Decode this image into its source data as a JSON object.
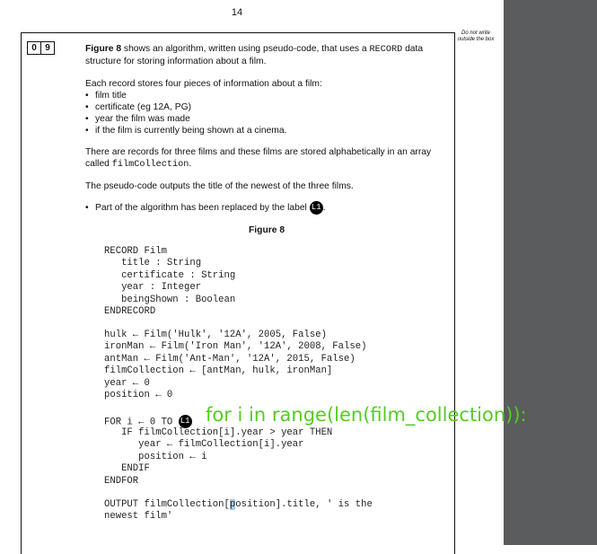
{
  "page_number": "14",
  "margin_note": "Do not write outside the box",
  "question_number": [
    "0",
    "9"
  ],
  "intro": {
    "fig_ref": "Figure 8",
    "text1": " shows an algorithm, written using pseudo-code, that uses a ",
    "record_word": "RECORD",
    "text2": " data structure for storing information about a film."
  },
  "record_intro": "Each record stores four pieces of information about a film:",
  "bullets": [
    "film title",
    "certificate (eg 12A, PG)",
    "year the film was made",
    "if the film is currently being shown at a cinema."
  ],
  "array_text": "There are records for three films and these films are stored alphabetically in an array called ",
  "array_name": "filmCollection",
  "array_end": ".",
  "output_text": "The pseudo-code outputs the title of the newest of the three films.",
  "replaced_text": "Part of the algorithm has been replaced by the label ",
  "label": "L1",
  "figure_caption": "Figure 8",
  "code_block1": "RECORD Film\n   title : String\n   certificate : String\n   year : Integer\n   beingShown : Boolean\nENDRECORD",
  "code_block2": "hulk ← Film('Hulk', '12A', 2005, False)\nironMan ← Film('Iron Man', '12A', 2008, False)\nantMan ← Film('Ant-Man', '12A', 2015, False)\nfilmCollection ← [antMan, hulk, ironMan]\nyear ← 0\nposition ← 0",
  "for_line_prefix": "FOR i ← 0 TO ",
  "code_block3": "   IF filmCollection[i].year > year THEN\n      year ← filmCollection[i].year\n      position ← i\n   ENDIF\nENDFOR",
  "output_line_a": "OUTPUT filmCollection[",
  "output_cursor_char": "p",
  "output_line_b": "osition].title, ' is the\nnewest film'",
  "python_overlay": "for i in range(len(film_collection)):"
}
